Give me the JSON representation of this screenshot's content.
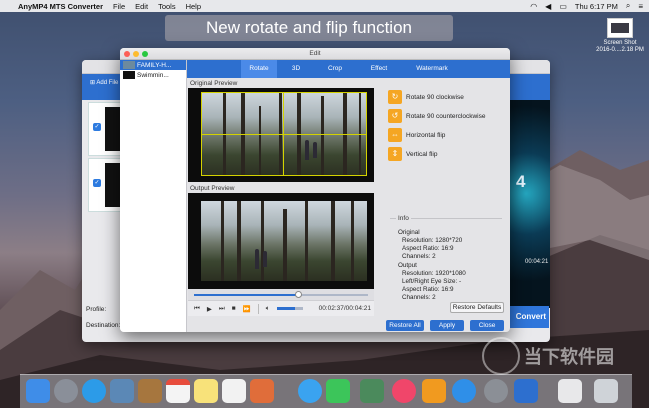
{
  "menubar": {
    "app": "AnyMP4 MTS Converter",
    "items": [
      "File",
      "Edit",
      "Tools",
      "Help"
    ],
    "time": "Thu 6:17 PM"
  },
  "banner": {
    "text": "New rotate and flip function"
  },
  "desktop_icon": {
    "label_line1": "Screen Shot",
    "label_line2": "2016-0....2.18 PM"
  },
  "main_window": {
    "add_file": "Add File",
    "profile_label": "Profile:",
    "destination_label": "Destination:",
    "convert_label": "Convert",
    "time": "00:04:21",
    "preview_text": "4"
  },
  "edit_dialog": {
    "title": "Edit",
    "files": [
      {
        "name": "FAMILY-H...",
        "selected": true
      },
      {
        "name": "Swimmin...",
        "selected": false
      }
    ],
    "tabs": [
      {
        "label": "Rotate",
        "active": true
      },
      {
        "label": "3D"
      },
      {
        "label": "Crop"
      },
      {
        "label": "Effect"
      },
      {
        "label": "Watermark"
      }
    ],
    "original_preview_label": "Original Preview",
    "output_preview_label": "Output Preview",
    "rotate_options": [
      {
        "label": "Rotate 90 clockwise",
        "icon": "rotate-clockwise-icon"
      },
      {
        "label": "Rotate 90 counterclockwise",
        "icon": "rotate-counterclockwise-icon"
      },
      {
        "label": "Horizontal flip",
        "icon": "horizontal-flip-icon"
      },
      {
        "label": "Vertical flip",
        "icon": "vertical-flip-icon"
      }
    ],
    "info": {
      "heading": "Info",
      "original_heading": "Original",
      "original_resolution": "Resolution: 1280*720",
      "original_aspect": "Aspect Ratio: 16:9",
      "original_channels": "Channels: 2",
      "output_heading": "Output",
      "output_resolution": "Resolution: 1920*1080",
      "output_eye": "Left/Right Eye Size: -",
      "output_aspect": "Aspect Ratio: 16:9",
      "output_channels": "Channels: 2"
    },
    "restore_defaults": "Restore Defaults",
    "restore_all": "Restore All",
    "apply": "Apply",
    "close": "Close",
    "timecode": "00:02:37/00:04:21",
    "playback_progress": 0.6,
    "volume_level": 0.7
  },
  "watermark": "当下软件园",
  "colors": {
    "accent": "#2d6fcf",
    "option_icon": "#f5a623",
    "crop_frame": "#d4d200"
  }
}
